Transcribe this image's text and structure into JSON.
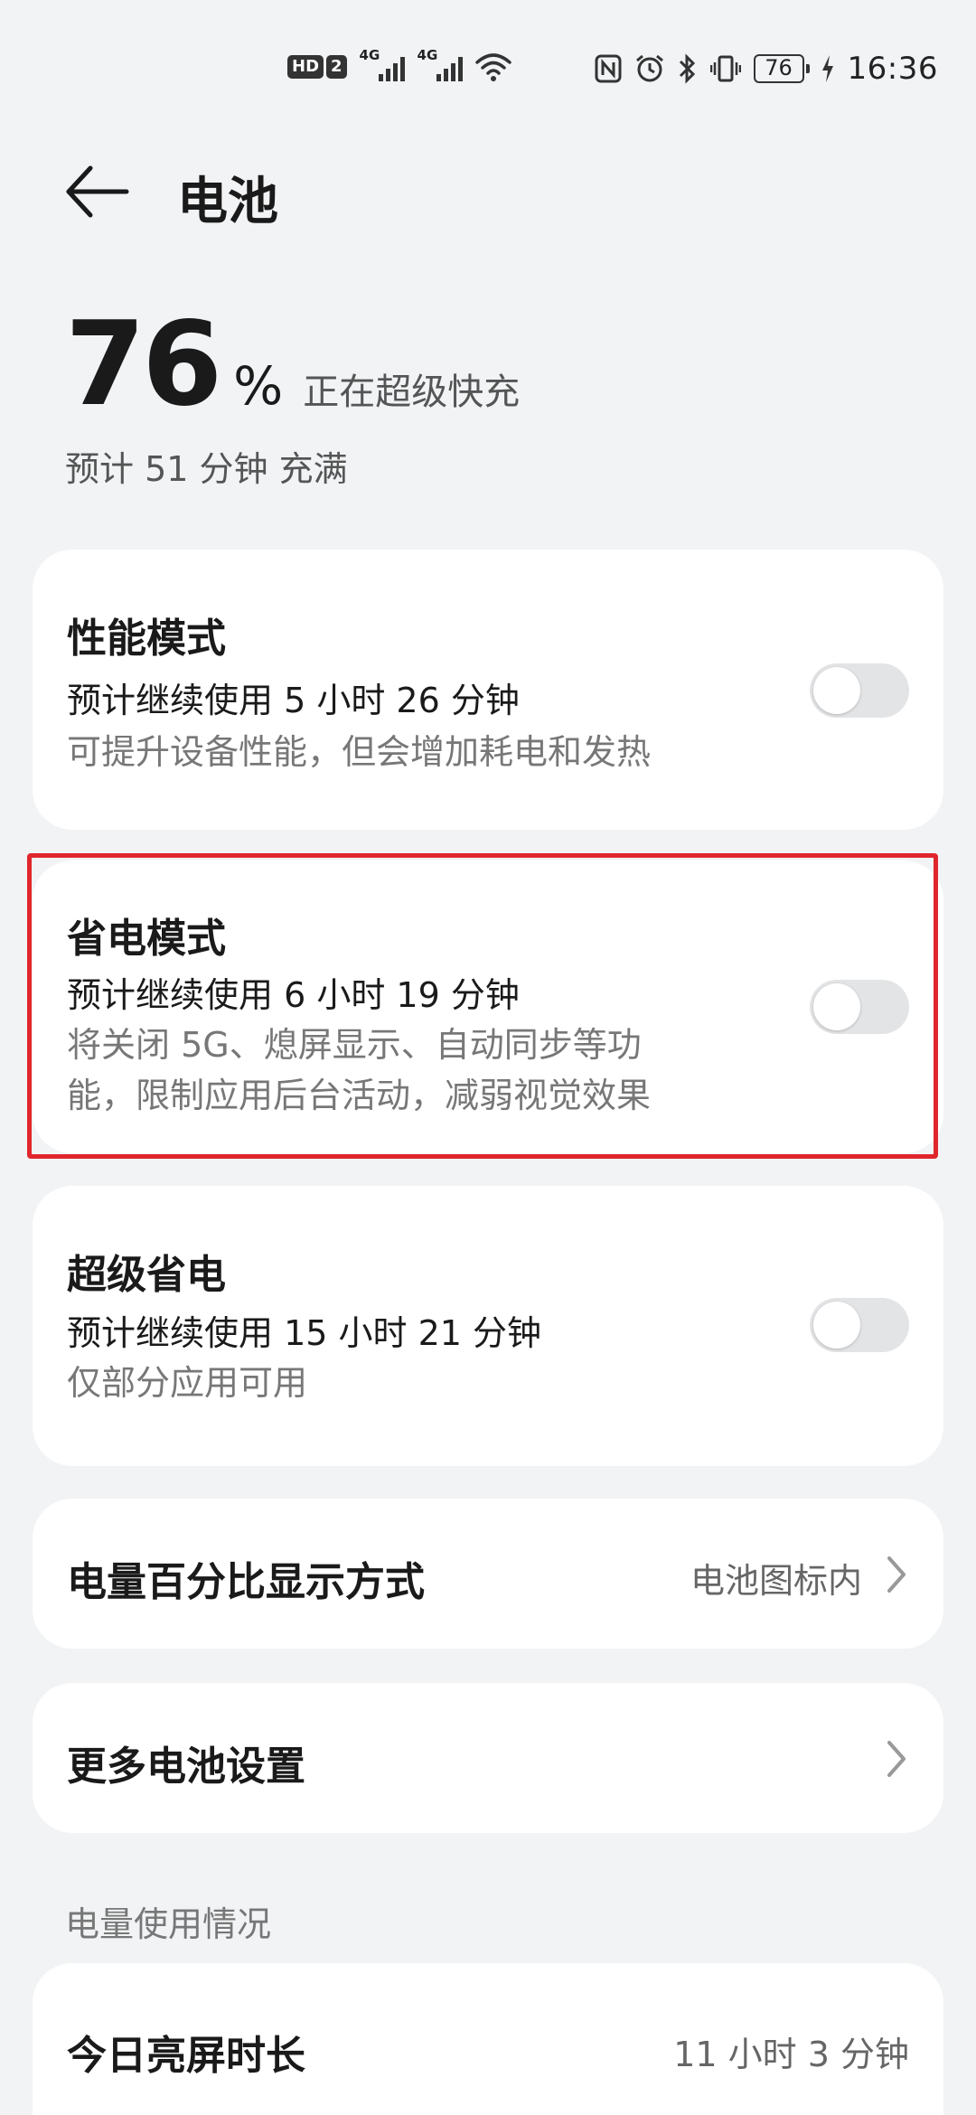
{
  "status_bar": {
    "hd_label": "HD",
    "sim_number": "2",
    "sim1_gen": "4G",
    "sim2_gen": "4G",
    "battery_level": "76",
    "time": "16:36"
  },
  "header": {
    "title": "电池"
  },
  "battery": {
    "level": "76",
    "percent_sign": "%",
    "status": "正在超级快充",
    "eta": "预计 51 分钟 充满"
  },
  "modes": [
    {
      "title": "性能模式",
      "estimate": "预计继续使用 5 小时 26 分钟",
      "description": "可提升设备性能，但会增加耗电和发热",
      "enabled": false
    },
    {
      "title": "省电模式",
      "estimate": "预计继续使用 6 小时 19 分钟",
      "description_line1": "将关闭 5G、熄屏显示、自动同步等功",
      "description_line2": "能，限制应用后台活动，减弱视觉效果",
      "enabled": false
    },
    {
      "title": "超级省电",
      "estimate": "预计继续使用 15 小时 21 分钟",
      "description": "仅部分应用可用",
      "enabled": false
    }
  ],
  "percent_display": {
    "title": "电量百分比显示方式",
    "value": "电池图标内"
  },
  "more_settings": {
    "title": "更多电池设置"
  },
  "usage": {
    "section_label": "电量使用情况",
    "screen_on_title": "今日亮屏时长",
    "screen_on_value": "11 小时 3 分钟"
  },
  "colors": {
    "highlight": "#e0262c",
    "background": "#f1f3f5",
    "card": "#ffffff"
  }
}
